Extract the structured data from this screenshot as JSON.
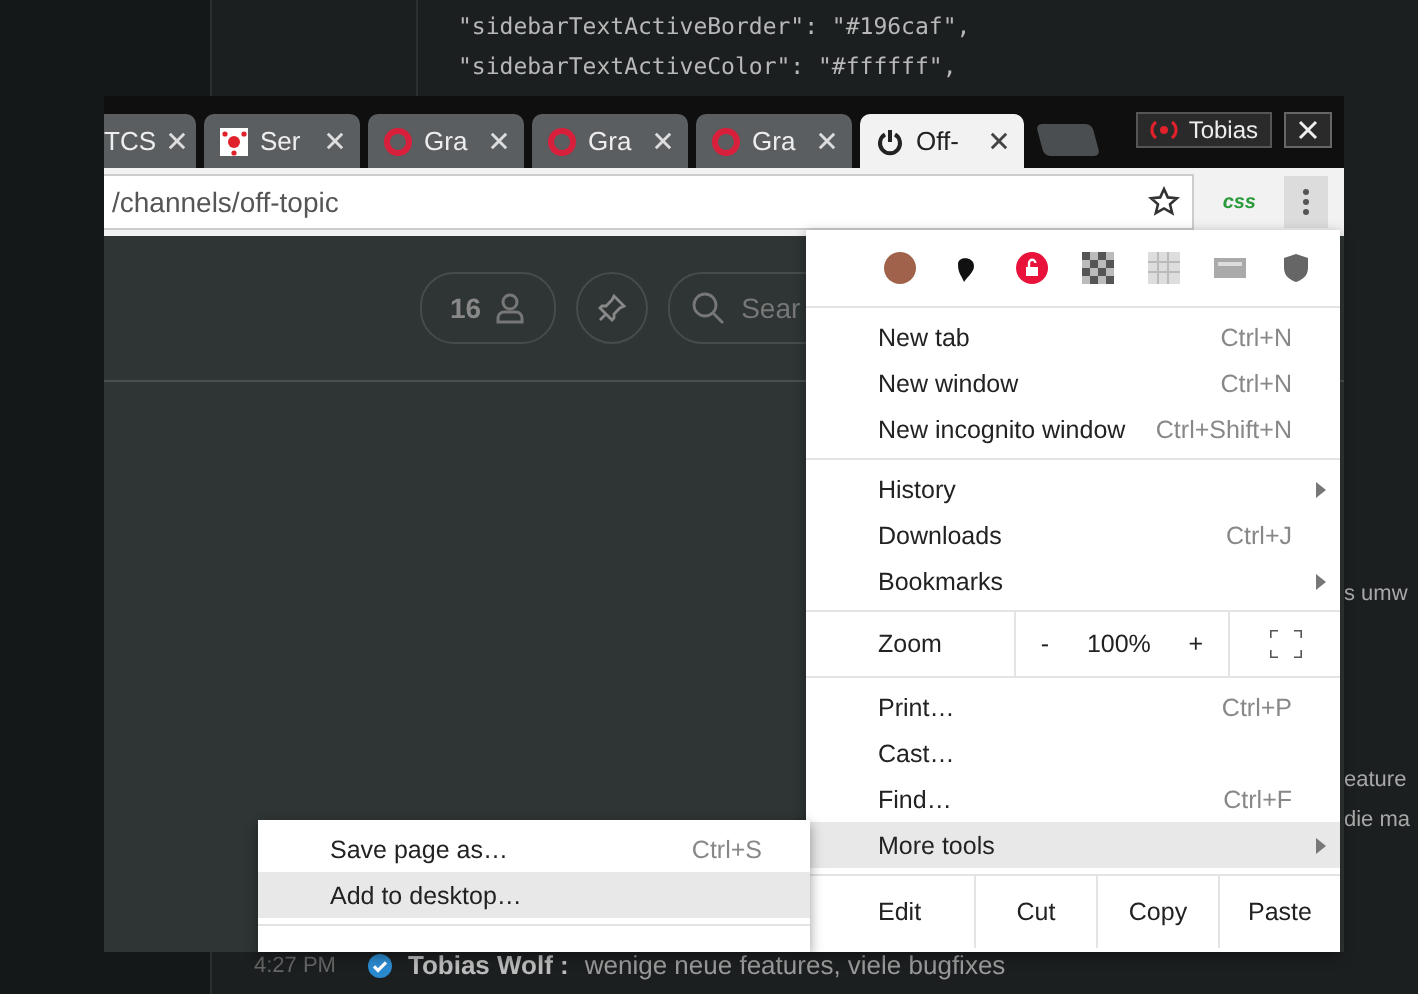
{
  "editor": {
    "code_lines": [
      "\"sidebarTextActiveBorder\": \"#196caf\",",
      "\"sidebarTextActiveColor\": \"#ffffff\","
    ]
  },
  "chat": {
    "fragments": [
      "s umw",
      "eature",
      "die ma"
    ],
    "message": {
      "time": "4:27 PM",
      "author": "Tobias Wolf :",
      "text": "wenige neue features, viele bugfixes"
    }
  },
  "browser": {
    "tabs": [
      {
        "label": "TCS",
        "kind": "plain",
        "selected": false
      },
      {
        "label": "Ser",
        "kind": "molecule",
        "selected": false
      },
      {
        "label": "Gra",
        "kind": "ring",
        "selected": false
      },
      {
        "label": "Gra",
        "kind": "ring",
        "selected": false
      },
      {
        "label": "Gra",
        "kind": "ring",
        "selected": false
      },
      {
        "label": "Off-",
        "kind": "power",
        "selected": true
      }
    ],
    "profile": "Tobias",
    "address": "/channels/off-topic",
    "extension_badge": "css",
    "page": {
      "member_count": "16",
      "search_placeholder": "Sear"
    }
  },
  "menu": {
    "sections": [
      {
        "kind": "items",
        "items": [
          {
            "label": "New tab",
            "shortcut": "Ctrl+N",
            "submenu": false,
            "selected": false
          },
          {
            "label": "New window",
            "shortcut": "Ctrl+N",
            "submenu": false,
            "selected": false
          },
          {
            "label": "New incognito window",
            "shortcut": "Ctrl+Shift+N",
            "submenu": false,
            "selected": false
          }
        ]
      },
      {
        "kind": "items",
        "items": [
          {
            "label": "History",
            "submenu": true,
            "selected": false
          },
          {
            "label": "Downloads",
            "shortcut": "Ctrl+J",
            "submenu": false,
            "selected": false
          },
          {
            "label": "Bookmarks",
            "submenu": true,
            "selected": false
          }
        ]
      },
      {
        "kind": "zoom",
        "label": "Zoom",
        "minus": "-",
        "value": "100%",
        "plus": "+"
      },
      {
        "kind": "items",
        "items": [
          {
            "label": "Print…",
            "shortcut": "Ctrl+P",
            "submenu": false,
            "selected": false
          },
          {
            "label": "Cast…",
            "submenu": false,
            "selected": false
          },
          {
            "label": "Find…",
            "shortcut": "Ctrl+F",
            "submenu": false,
            "selected": false
          },
          {
            "label": "More tools",
            "submenu": true,
            "selected": true
          }
        ]
      },
      {
        "kind": "edit",
        "label": "Edit",
        "actions": [
          "Cut",
          "Copy",
          "Paste"
        ]
      }
    ]
  },
  "submenu": {
    "items": [
      {
        "label": "Save page as…",
        "shortcut": "Ctrl+S",
        "selected": false
      },
      {
        "label": "Add to desktop…",
        "selected": true
      }
    ]
  }
}
